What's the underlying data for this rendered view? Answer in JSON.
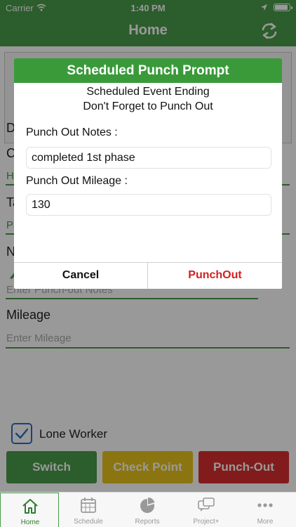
{
  "status_bar": {
    "carrier": "Carrier",
    "time": "1:40 PM"
  },
  "navbar": {
    "title": "Home"
  },
  "form": {
    "label_partial_1": "D",
    "label_partial_2": "C",
    "value_partial_1": "H",
    "label_partial_3": "Ta",
    "value_partial_2": "Pa",
    "label_partial_4": "N",
    "notes_placeholder": "Enter Punch-out Notes",
    "mileage_label": "Mileage",
    "mileage_placeholder": "Enter Mileage"
  },
  "lone_worker": {
    "label": "Lone Worker",
    "checked": true
  },
  "actions": {
    "switch_label": "Switch",
    "checkpoint_label": "Check Point",
    "punchout_label": "Punch-Out"
  },
  "modal": {
    "title": "Scheduled Punch Prompt",
    "subtitle_1": "Scheduled Event Ending",
    "subtitle_2": "Don't Forget to Punch Out",
    "notes_label": "Punch Out Notes :",
    "notes_value": "completed 1st phase",
    "mileage_label": "Punch Out Mileage :",
    "mileage_value": "130",
    "cancel_label": "Cancel",
    "punch_label": "PunchOut"
  },
  "tabs": [
    {
      "label": "Home",
      "icon": "home-icon",
      "active": true
    },
    {
      "label": "Schedule",
      "icon": "calendar-icon",
      "active": false
    },
    {
      "label": "Reports",
      "icon": "pie-chart-icon",
      "active": false
    },
    {
      "label": "Project+",
      "icon": "chat-bubbles-icon",
      "active": false
    },
    {
      "label": "More",
      "icon": "more-icon",
      "active": false
    }
  ],
  "colors": {
    "brand_green": "#4a9b4a",
    "warning_yellow": "#e8c41c",
    "danger_red": "#d93030",
    "checkbox_blue": "#2a6fc9"
  }
}
